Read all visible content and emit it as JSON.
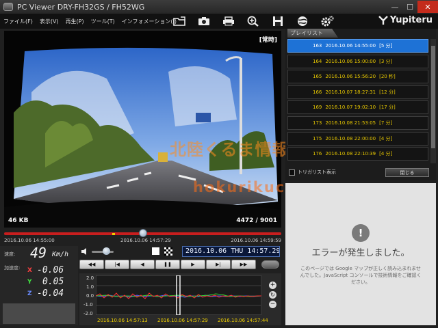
{
  "window": {
    "title": "PC Viewer   DRY-FH32GS / FH52WG"
  },
  "menu": [
    "ファイル(F)",
    "表示(V)",
    "再生(P)",
    "ツール(T)",
    "インフォメーション(I)"
  ],
  "toolbar": [
    "open-folder-icon",
    "camera-icon",
    "print-icon",
    "zoom-icon",
    "save-icon",
    "globe-icon",
    "settings-icon"
  ],
  "brand": {
    "name": "Yupiteru"
  },
  "video": {
    "mode_label": "[常時]",
    "size_label": "46 KB",
    "frame_label": "4472 / 9001",
    "watermark_text": "北陸くるま情報サイト",
    "watermark_url": "hokurikucar.com"
  },
  "timeline": {
    "start": "2016.10.06 14:55:00",
    "current": "2016.10.06 14:57:29",
    "end": "2016.10.06 14:59:59",
    "position": 0.5
  },
  "speed": {
    "label": "速度:",
    "value": "49",
    "unit": "Km/h"
  },
  "accel": {
    "label": "加速度:",
    "axes": [
      {
        "axis": "X",
        "value": "-0.06",
        "color": "#ff4040"
      },
      {
        "axis": "Y",
        "value": "0.05",
        "color": "#40e040"
      },
      {
        "axis": "Z",
        "value": "-0.04",
        "color": "#6a8cff"
      }
    ]
  },
  "controls": {
    "datetime": "2016.10.06 THU 14:57.29",
    "buttons": [
      "rewind-icon",
      "skip-start-icon",
      "step-back-icon",
      "pause-icon",
      "play-icon",
      "step-forward-icon",
      "fast-forward-icon"
    ]
  },
  "graph": {
    "y_ticks": [
      "2.0",
      "1.0",
      "0.0",
      "-1.0",
      "-2.0"
    ],
    "x_labels": [
      "2016.10.06 14:57:13",
      "2016.10.06 14:57:29",
      "2016.10.06 14:57:44"
    ],
    "side_buttons": [
      "+",
      "↻",
      "−"
    ]
  },
  "playlist": {
    "tab_label": "プレイリスト",
    "items": [
      {
        "num": "163",
        "datetime": "2016.10.06 14:55:00",
        "duration": "[5 分]"
      },
      {
        "num": "164",
        "datetime": "2016.10.06 15:00:00",
        "duration": "[3 分]"
      },
      {
        "num": "165",
        "datetime": "2016.10.06 15:56:20",
        "duration": "[20 秒]"
      },
      {
        "num": "166",
        "datetime": "2016.10.07 18:27:31",
        "duration": "[12 分]"
      },
      {
        "num": "169",
        "datetime": "2016.10.07 19:02:10",
        "duration": "[17 分]"
      },
      {
        "num": "173",
        "datetime": "2016.10.08 21:53:05",
        "duration": "[7 分]"
      },
      {
        "num": "175",
        "datetime": "2016.10.08 22:00:00",
        "duration": "[4 分]"
      },
      {
        "num": "176",
        "datetime": "2016.10.08 22:10:39",
        "duration": "[4 分]"
      }
    ],
    "selected_index": 0,
    "trigger_label": "トリガリスト表示",
    "close_label": "閉じる"
  },
  "map": {
    "error_title": "エラーが発生しました。",
    "error_message": "このページでは Google マップが正しく読み込まれませんでした。JavaScript コンソールで技術情報をご確認ください。"
  }
}
